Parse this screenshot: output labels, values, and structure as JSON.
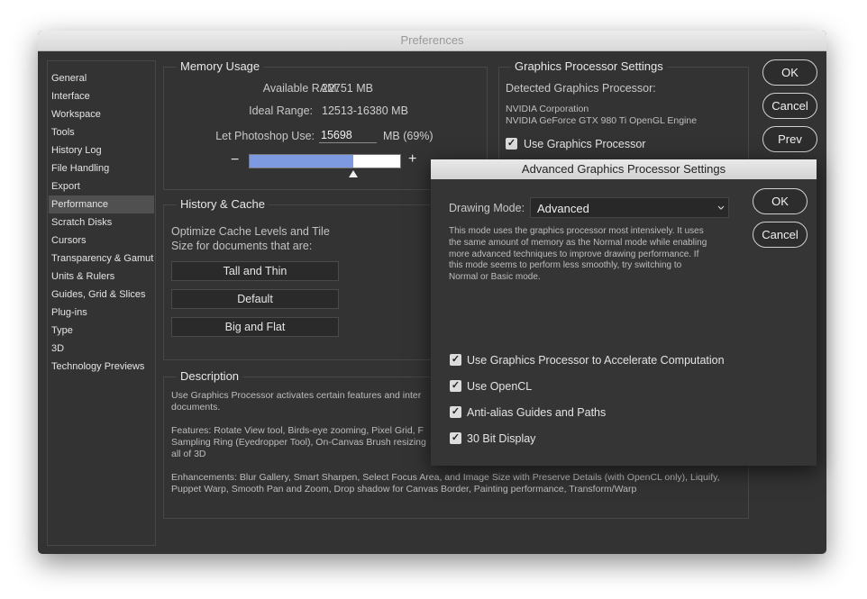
{
  "window": {
    "title": "Preferences"
  },
  "sidebar": {
    "items": [
      {
        "label": "General"
      },
      {
        "label": "Interface"
      },
      {
        "label": "Workspace"
      },
      {
        "label": "Tools"
      },
      {
        "label": "History Log"
      },
      {
        "label": "File Handling"
      },
      {
        "label": "Export"
      },
      {
        "label": "Performance"
      },
      {
        "label": "Scratch Disks"
      },
      {
        "label": "Cursors"
      },
      {
        "label": "Transparency & Gamut"
      },
      {
        "label": "Units & Rulers"
      },
      {
        "label": "Guides, Grid & Slices"
      },
      {
        "label": "Plug-ins"
      },
      {
        "label": "Type"
      },
      {
        "label": "3D"
      },
      {
        "label": "Technology Previews"
      }
    ],
    "selected": "Performance"
  },
  "memory": {
    "title": "Memory Usage",
    "available_label": "Available RAM:",
    "available_value": "22751 MB",
    "ideal_label": "Ideal Range:",
    "ideal_value": "12513-16380 MB",
    "let_use_label": "Let Photoshop Use:",
    "let_use_value": "15698",
    "let_use_unit": "MB (69%)",
    "minus": "−",
    "plus": "+",
    "slider_fraction": 0.69
  },
  "history": {
    "title": "History & Cache",
    "text_line1": "Optimize Cache Levels and Tile",
    "text_line2": "Size for documents that are:",
    "buttons": [
      "Tall and Thin",
      "Default",
      "Big and Flat"
    ]
  },
  "gpu": {
    "title": "Graphics Processor Settings",
    "detected_label": "Detected Graphics Processor:",
    "vendor": "NVIDIA Corporation",
    "model": "NVIDIA GeForce GTX 980 Ti OpenGL Engine",
    "use_gpu_label": "Use Graphics Processor",
    "use_gpu_checked": true
  },
  "description": {
    "title": "Description",
    "lines": [
      "Use Graphics Processor activates certain features and inter",
      "documents.",
      "",
      "Features: Rotate View tool, Birds-eye zooming, Pixel Grid, F",
      "Sampling Ring (Eyedropper Tool), On-Canvas Brush resizing",
      "all of 3D",
      "",
      "Enhancements: Blur Gallery, Smart Sharpen, Select Focus Area, and Image Size with Preserve Details (with OpenCL only), Liquify,",
      "Puppet Warp, Smooth Pan and Zoom, Drop shadow for Canvas Border, Painting performance, Transform/Warp"
    ]
  },
  "main_buttons": {
    "ok": "OK",
    "cancel": "Cancel",
    "prev": "Prev"
  },
  "advanced_dialog": {
    "title": "Advanced Graphics Processor Settings",
    "drawing_mode_label": "Drawing Mode:",
    "drawing_mode_value": "Advanced",
    "explanation_lines": [
      "This mode uses the graphics processor most intensively.  It uses",
      "the same amount of memory as the Normal mode while enabling",
      "more advanced techniques to improve drawing performance.  If",
      "this mode seems to perform less smoothly, try switching to",
      "Normal or Basic mode."
    ],
    "checkboxes": [
      {
        "label": "Use Graphics Processor to Accelerate Computation",
        "checked": true
      },
      {
        "label": "Use OpenCL",
        "checked": true
      },
      {
        "label": "Anti-alias Guides and Paths",
        "checked": true
      },
      {
        "label": "30 Bit Display",
        "checked": true
      }
    ],
    "ok": "OK",
    "cancel": "Cancel",
    "check_glyph": "✓"
  }
}
